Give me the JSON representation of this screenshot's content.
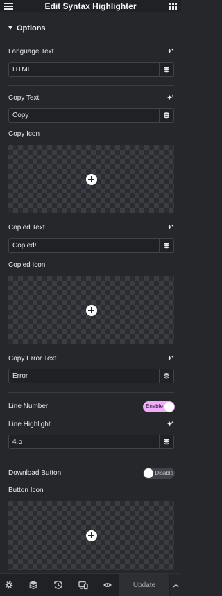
{
  "header": {
    "title": "Edit Syntax Highlighter",
    "menu_icon": "hamburger-icon",
    "widgets_icon": "grid-icon"
  },
  "section": {
    "title": "Options",
    "expanded": true
  },
  "fields": {
    "language_text": {
      "label": "Language Text",
      "value": "HTML"
    },
    "copy_text": {
      "label": "Copy Text",
      "value": "Copy"
    },
    "copy_icon": {
      "label": "Copy Icon"
    },
    "copied_text": {
      "label": "Copied Text",
      "value": "Copied!"
    },
    "copied_icon": {
      "label": "Copied Icon"
    },
    "copy_error_text": {
      "label": "Copy Error Text",
      "value": "Error"
    },
    "line_number": {
      "label": "Line Number",
      "toggle_label": "Enable",
      "enabled": true
    },
    "line_highlight": {
      "label": "Line Highlight",
      "value": "4,5"
    },
    "download_button": {
      "label": "Download Button",
      "toggle_label": "Disable",
      "enabled": false
    },
    "button_icon": {
      "label": "Button Icon"
    }
  },
  "footer": {
    "icons": [
      "gear-icon",
      "layers-icon",
      "history-icon",
      "responsive-icon",
      "eye-icon"
    ],
    "update_label": "Update"
  },
  "colors": {
    "panel_bg": "#26272b",
    "header_bg": "#1f2124",
    "input_bg": "#1f2124",
    "toggle_on": "#f0abfc",
    "text": "#e6e8ea"
  }
}
